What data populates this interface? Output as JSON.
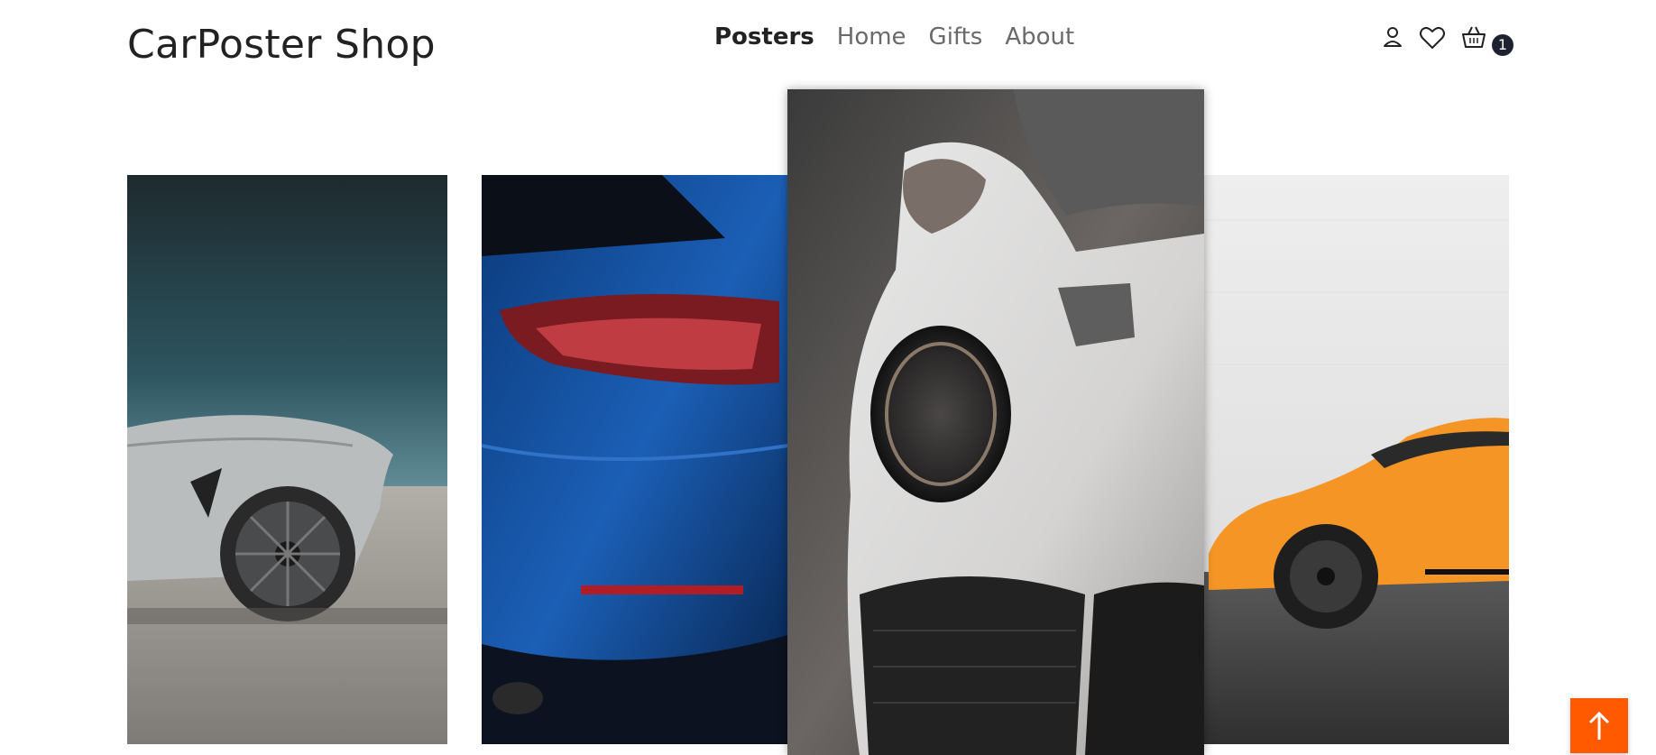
{
  "brand": {
    "name": "CarPoster Shop"
  },
  "nav": [
    {
      "label": "Posters",
      "active": true
    },
    {
      "label": "Home",
      "active": false
    },
    {
      "label": "Gifts",
      "active": false
    },
    {
      "label": "About",
      "active": false
    }
  ],
  "header_icons": [
    "user-icon",
    "heart-icon",
    "basket-icon"
  ],
  "cart": {
    "count": "1"
  },
  "posters": [
    {
      "subject": "grey-car-front-wheel"
    },
    {
      "subject": "blue-car-tail-light"
    },
    {
      "subject": "white-car-headlight",
      "highlighted": true
    },
    {
      "subject": "orange-car-side"
    }
  ],
  "scroll_top": {
    "icon": "arrow-up-icon"
  },
  "colors": {
    "accent": "#ff5a00",
    "badge": "#1e2230",
    "text": "#222222",
    "nav_inactive": "#6a6a6a"
  }
}
